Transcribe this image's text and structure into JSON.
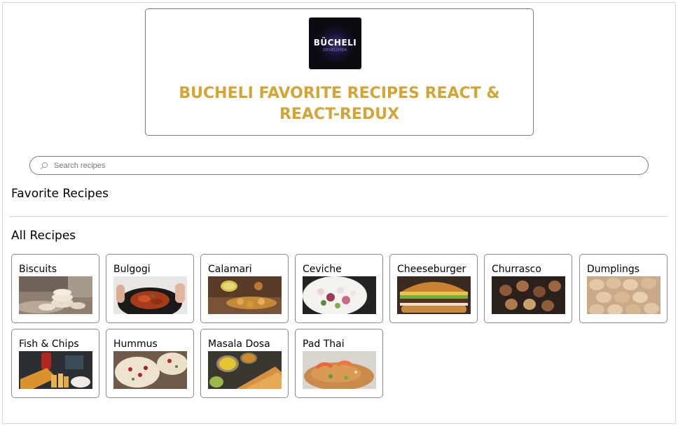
{
  "header": {
    "logo_text": "BÜCHELI",
    "logo_subtext": "DEVELOPER",
    "title": "BUCHELI FAVORITE RECIPES REACT & REACT-REDUX"
  },
  "search": {
    "placeholder": "Search recipes",
    "value": ""
  },
  "sections": {
    "favorites_title": "Favorite Recipes",
    "all_title": "All Recipes"
  },
  "recipes": [
    {
      "name": "Biscuits",
      "image": "biscuits-photo"
    },
    {
      "name": "Bulgogi",
      "image": "bulgogi-photo"
    },
    {
      "name": "Calamari",
      "image": "calamari-photo"
    },
    {
      "name": "Ceviche",
      "image": "ceviche-photo"
    },
    {
      "name": "Cheeseburger",
      "image": "cheeseburger-photo"
    },
    {
      "name": "Churrasco",
      "image": "churrasco-photo"
    },
    {
      "name": "Dumplings",
      "image": "dumplings-photo"
    },
    {
      "name": "Fish & Chips",
      "image": "fish-and-chips-photo"
    },
    {
      "name": "Hummus",
      "image": "hummus-photo"
    },
    {
      "name": "Masala Dosa",
      "image": "masala-dosa-photo"
    },
    {
      "name": "Pad Thai",
      "image": "pad-thai-photo"
    }
  ],
  "colors": {
    "title_gold": "#d4a535",
    "border_gray": "#8a8a8a",
    "logo_background": "#0b0b12"
  }
}
